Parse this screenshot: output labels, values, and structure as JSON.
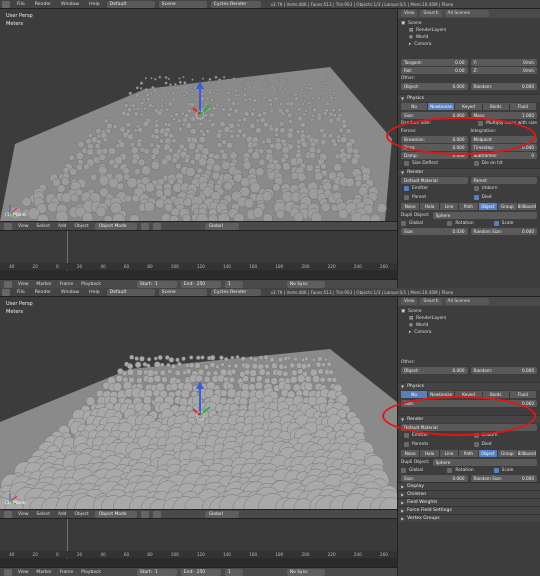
{
  "top": {
    "header": {
      "menus": [
        "File",
        "Render",
        "Window",
        "Help"
      ],
      "layout": "Default",
      "scene": "Scene",
      "engine": "Cycles Render",
      "stats": "v2.79 | Verts:486 | Faces:513 | Tris:953 | Objects:1/3 | Lamps:0/1 | Mem:16.45M | Plane"
    },
    "viewport": {
      "title": "User Persp",
      "units": "Meters",
      "object_label": "(1) Plane",
      "menus": [
        "View",
        "Select",
        "Add",
        "Object"
      ],
      "mode": "Object Mode",
      "pivot": "Global"
    },
    "timeline": {
      "ticks": [
        "40",
        "20",
        "0",
        "20",
        "40",
        "60",
        "80",
        "100",
        "120",
        "140",
        "160",
        "180",
        "200",
        "220",
        "240",
        "260"
      ],
      "menus": [
        "View",
        "Marker",
        "Frame",
        "Playback"
      ],
      "start": "Start:",
      "start_val": "1",
      "end": "End:",
      "end_val": "250",
      "frame": "1",
      "sync": "No Sync"
    },
    "props": {
      "header_tabs": [
        "View",
        "Search",
        "All Scenes"
      ],
      "tree": [
        "Scene",
        "RenderLayers",
        "World",
        "Camera"
      ],
      "tangent_label": "Tangent:",
      "tangent_val": "0.00",
      "rot_label": "Rot:",
      "rot_val": "0.00",
      "y_label": "Y:",
      "y_val": "0mm",
      "z_label": "Z:",
      "z_val": "0mm",
      "other": "Other:",
      "object_label": "Object:",
      "object_val": "0.000",
      "random_label": "Random:",
      "random_val": "0.000",
      "physics": "Physics",
      "physics_types": [
        "No",
        "Newtonian",
        "Keyed",
        "Boids",
        "Fluid"
      ],
      "physics_selected": 1,
      "size_label": "Size:",
      "size_val": "0.060",
      "mass_label": "Mass:",
      "mass_val": "1.000",
      "random_size": "Random Size:",
      "mult_size": "Multiply mass with size",
      "forces": "Forces:",
      "integration": "Integration:",
      "brownian_label": "Brownian:",
      "brownian_val": "0.000",
      "midpoint": "Midpoint",
      "drag_label": "Drag:",
      "drag_val": "0.000",
      "timestep_label": "Timestep:",
      "timestep_val": "0.040",
      "damp_label": "Damp:",
      "damp_val": "0.000",
      "subframes_label": "Subframes:",
      "subframes_val": "0",
      "size_deflect": "Size Deflect",
      "die_on_hit": "Die on hit",
      "render": "Render",
      "material": "Default Material",
      "parent": "Parent",
      "emitter": "Emitter",
      "unborn": "Unborn",
      "died": "Died",
      "render_types": [
        "None",
        "Halo",
        "Line",
        "Path",
        "Object",
        "Group",
        "Billboard"
      ],
      "render_selected": 4,
      "dupli_label": "Dupli Object:",
      "dupli_val": "Sphere",
      "global": "Global",
      "rotation": "Rotation",
      "scale": "Scale",
      "size2_label": "Size:",
      "size2_val": "0.030",
      "random_size2_label": "Random Size:",
      "random_size2_val": "0.000"
    }
  },
  "bottom": {
    "header": {
      "menus": [
        "File",
        "Render",
        "Window",
        "Help"
      ],
      "layout": "Default",
      "scene": "Scene",
      "engine": "Cycles Render",
      "stats": "v2.79 | Verts:486 | Faces:513 | Tris:953 | Objects:1/3 | Lamps:0/1 | Mem:16.45M | Plane"
    },
    "viewport": {
      "title": "User Persp",
      "units": "Meters",
      "object_label": "(1) Plane",
      "menus": [
        "View",
        "Select",
        "Add",
        "Object"
      ],
      "mode": "Object Mode",
      "pivot": "Global"
    },
    "timeline": {
      "ticks": [
        "40",
        "20",
        "0",
        "20",
        "40",
        "60",
        "80",
        "100",
        "120",
        "140",
        "160",
        "180",
        "200",
        "220",
        "240",
        "260"
      ],
      "menus": [
        "View",
        "Marker",
        "Frame",
        "Playback"
      ],
      "start": "Start:",
      "start_val": "1",
      "end": "End:",
      "end_val": "250",
      "frame": "1",
      "sync": "No Sync"
    },
    "props": {
      "header_tabs": [
        "View",
        "Search",
        "All Scenes"
      ],
      "tree": [
        "Scene",
        "RenderLayers",
        "World",
        "Camera"
      ],
      "other": "Other:",
      "object_label": "Object:",
      "object_val": "0.000",
      "random_label": "Random:",
      "random_val": "0.000",
      "physics": "Physics",
      "physics_types": [
        "No",
        "Newtonian",
        "Keyed",
        "Boids",
        "Fluid"
      ],
      "physics_selected": 0,
      "size_label": "Size:",
      "size_val": "0.060",
      "render": "Render",
      "material": "Default Material",
      "emitter": "Emitter",
      "unborn": "Unborn",
      "parents": "Parents",
      "died": "Died",
      "render_types": [
        "None",
        "Halo",
        "Line",
        "Path",
        "Object",
        "Group",
        "Billboard"
      ],
      "render_selected": 4,
      "dupli_label": "Dupli Object:",
      "dupli_val": "Sphere",
      "global": "Global",
      "rotation": "Rotation",
      "scale": "Scale",
      "size2_label": "Size:",
      "size2_val": "0.060",
      "random_size2_label": "Random Size:",
      "random_size2_val": "0.000",
      "sections": [
        "Display",
        "Children",
        "Field Weights",
        "Force Field Settings",
        "Vertex Groups"
      ]
    }
  },
  "colors": {
    "selected": "#5680c2",
    "highlight_ring": "#e81313",
    "timeline_cursor": "#3f9a2a"
  }
}
